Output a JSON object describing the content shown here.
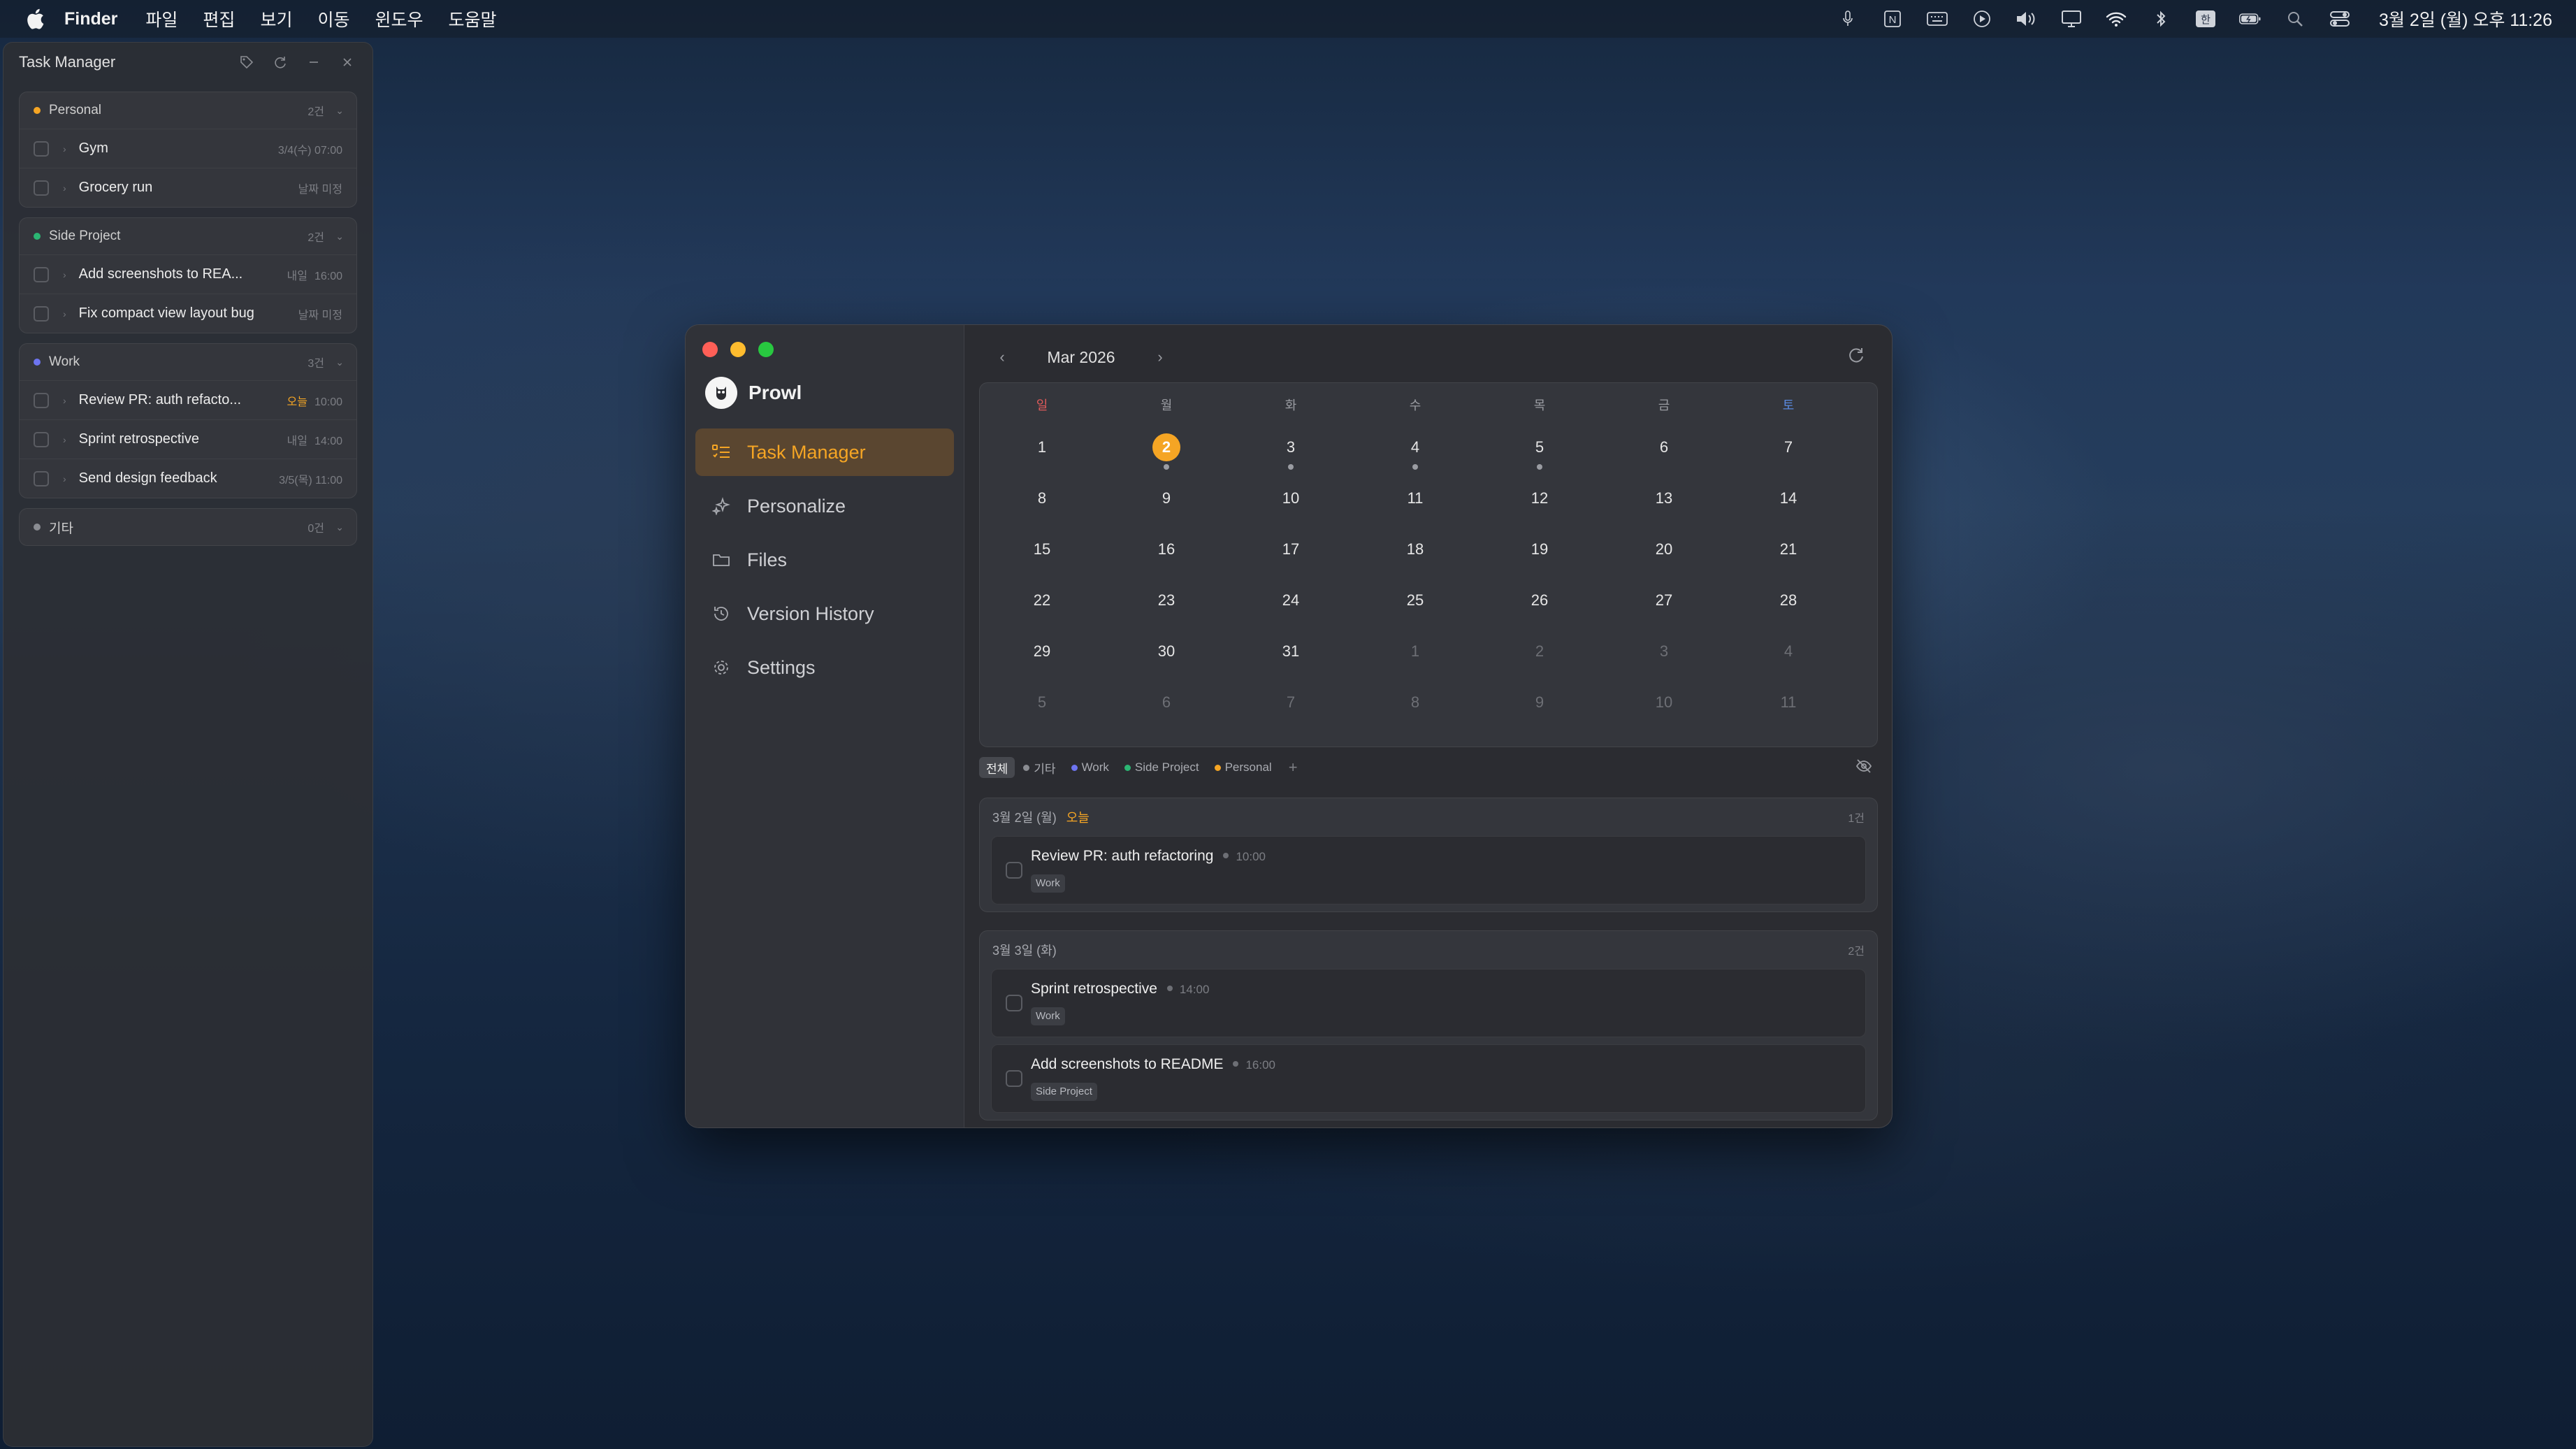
{
  "menubar": {
    "app_name": "Finder",
    "items": [
      "파일",
      "편집",
      "보기",
      "이동",
      "윈도우",
      "도움말"
    ],
    "clock": "3월 2일 (월) 오후 11:26",
    "status_icons": [
      "mic-icon",
      "notion-icon",
      "keyboard-icon",
      "play-icon",
      "volume-icon",
      "display-icon",
      "wifi-icon",
      "bluetooth-icon",
      "input-source-icon",
      "battery-icon",
      "spotlight-icon",
      "control-center-icon"
    ]
  },
  "task_panel": {
    "title": "Task Manager",
    "groups": [
      {
        "name": "Personal",
        "color": "#f5a524",
        "count": "2건",
        "tasks": [
          {
            "title": "Gym",
            "when": "3/4(수)",
            "time": "07:00",
            "badge": ""
          },
          {
            "title": "Grocery run",
            "when": "날짜 미정",
            "time": "",
            "badge": ""
          }
        ]
      },
      {
        "name": "Side Project",
        "color": "#2bb673",
        "count": "2건",
        "tasks": [
          {
            "title": "Add screenshots to REA...",
            "when": "",
            "time": "16:00",
            "badge": "내일"
          },
          {
            "title": "Fix compact view layout bug",
            "when": "날짜 미정",
            "time": "",
            "badge": ""
          }
        ]
      },
      {
        "name": "Work",
        "color": "#6d74f0",
        "count": "3건",
        "tasks": [
          {
            "title": "Review PR: auth refacto...",
            "when": "",
            "time": "10:00",
            "badge": "오늘"
          },
          {
            "title": "Sprint retrospective",
            "when": "",
            "time": "14:00",
            "badge": "내일"
          },
          {
            "title": "Send design feedback",
            "when": "3/5(목)",
            "time": "11:00",
            "badge": ""
          }
        ]
      },
      {
        "name": "기타",
        "color": "#8a8c92",
        "count": "0건",
        "tasks": []
      }
    ]
  },
  "window": {
    "app_name": "Prowl",
    "nav": [
      {
        "label": "Task Manager",
        "icon": "task-list-icon",
        "active": true
      },
      {
        "label": "Personalize",
        "icon": "sparkles-icon",
        "active": false
      },
      {
        "label": "Files",
        "icon": "folder-icon",
        "active": false
      },
      {
        "label": "Version History",
        "icon": "history-icon",
        "active": false
      },
      {
        "label": "Settings",
        "icon": "gear-icon",
        "active": false
      }
    ],
    "calendar": {
      "month_label": "Mar 2026",
      "weekdays": [
        "일",
        "월",
        "화",
        "수",
        "목",
        "금",
        "토"
      ],
      "weeks": [
        [
          "1",
          "2",
          "3",
          "4",
          "5",
          "6",
          "7"
        ],
        [
          "8",
          "9",
          "10",
          "11",
          "12",
          "13",
          "14"
        ],
        [
          "15",
          "16",
          "17",
          "18",
          "19",
          "20",
          "21"
        ],
        [
          "22",
          "23",
          "24",
          "25",
          "26",
          "27",
          "28"
        ],
        [
          "29",
          "30",
          "31",
          "1",
          "2",
          "3",
          "4"
        ],
        [
          "5",
          "6",
          "7",
          "8",
          "9",
          "10",
          "11"
        ]
      ],
      "today": "2",
      "days_with_tasks": [
        "2",
        "3",
        "4",
        "5"
      ]
    },
    "filters": [
      {
        "label": "전체",
        "color": "",
        "active": true
      },
      {
        "label": "기타",
        "color": "#8a8c92",
        "active": false
      },
      {
        "label": "Work",
        "color": "#6d74f0",
        "active": false
      },
      {
        "label": "Side Project",
        "color": "#2bb673",
        "active": false
      },
      {
        "label": "Personal",
        "color": "#f5a524",
        "active": false
      }
    ],
    "agenda": [
      {
        "date": "3월 2일 (월)",
        "today_label": "오늘",
        "count": "1건",
        "tasks": [
          {
            "title": "Review PR: auth refactoring",
            "time": "10:00",
            "tag": "Work"
          }
        ]
      },
      {
        "date": "3월 3일 (화)",
        "today_label": "",
        "count": "2건",
        "tasks": [
          {
            "title": "Sprint retrospective",
            "time": "14:00",
            "tag": "Work"
          },
          {
            "title": "Add screenshots to README",
            "time": "16:00",
            "tag": "Side Project"
          }
        ]
      }
    ]
  }
}
